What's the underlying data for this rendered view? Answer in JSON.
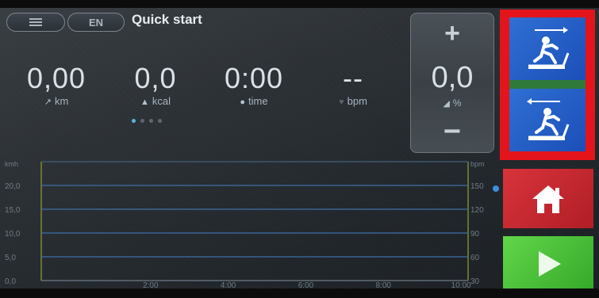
{
  "header": {
    "menu_icon": "hamburger-icon",
    "language": "EN",
    "title": "Quick start"
  },
  "metrics": [
    {
      "value": "0,00",
      "unit": "km",
      "icon": "distance-icon"
    },
    {
      "value": "0,0",
      "unit": "kcal",
      "icon": "flame-icon"
    },
    {
      "value": "0:00",
      "unit": "time",
      "icon": "stopwatch-icon"
    },
    {
      "value": "--",
      "unit": "bpm",
      "icon": "heart-icon"
    }
  ],
  "pager": {
    "count": 4,
    "active": 0
  },
  "incline": {
    "plus": "+",
    "value": "0,0",
    "unit": "%",
    "minus": "−",
    "icon": "incline-icon"
  },
  "chart_data": {
    "type": "line",
    "left_axis": {
      "label": "kmh",
      "ticks": [
        "0,0",
        "5,0",
        "10,0",
        "15,0",
        "20,0"
      ]
    },
    "right_axis": {
      "label": "bpm",
      "ticks": [
        "30",
        "60",
        "90",
        "120",
        "150"
      ]
    },
    "x_ticks": [
      "2:00",
      "4:00",
      "6:00",
      "8:00",
      "10:00"
    ],
    "series": []
  },
  "side": {
    "program_forward_icon": "treadmill-forward-icon",
    "program_reverse_icon": "treadmill-reverse-icon",
    "home_icon": "home-icon",
    "start_icon": "play-icon",
    "highlight_color": "#e3141b"
  }
}
